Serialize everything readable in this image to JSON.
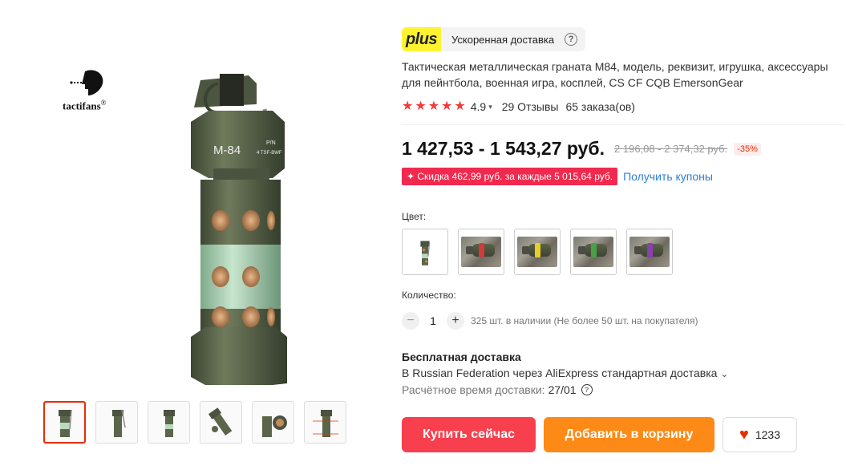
{
  "brand": {
    "name": "tactifans",
    "registered": "®"
  },
  "plus": {
    "badge": "plus",
    "text": "Ускоренная доставка",
    "help": "?"
  },
  "product": {
    "title": "Тактическая металлическая граната M84, модель, реквизит, игрушка, аксессуары для пейнтбола, военная игра, косплей, CS CF CQB EmersonGear",
    "body_marking": "M-84",
    "cap_marking_1": "P/N",
    "cap_marking_2": "4 TSF-BWF"
  },
  "rating": {
    "stars": 5,
    "value": "4.9",
    "reviews": "29 Отзывы",
    "orders": "65 заказа(ов)"
  },
  "price": {
    "current": "1 427,53 - 1 543,27 руб.",
    "old": "2 196,08 - 2 374,32 руб.",
    "discount": "-35%"
  },
  "coupon": {
    "badge": "✦ Скидка 462,99 руб. за каждые 5 015,64 руб.",
    "link": "Получить купоны"
  },
  "colors": {
    "label": "Цвет:",
    "swatches": [
      {
        "id": "grenade",
        "selected": false
      },
      {
        "id": "red",
        "band": "#d23a3a"
      },
      {
        "id": "yellow",
        "band": "#e6cf2a"
      },
      {
        "id": "green",
        "band": "#4a9f4a"
      },
      {
        "id": "purple",
        "band": "#8a3fb0"
      }
    ]
  },
  "quantity": {
    "label": "Количество:",
    "minus": "−",
    "plus": "+",
    "value": "1",
    "stock": "325 шт. в наличии (Не более 50 шт. на покупателя)"
  },
  "shipping": {
    "title": "Бесплатная доставка",
    "method": "В Russian Federation через AliExpress стандартная доставка",
    "method_chevron": "⌄",
    "eta_label": "Расчётное время доставки:",
    "eta_date": "27/01",
    "help": "?"
  },
  "actions": {
    "buy": "Купить сейчас",
    "cart": "Добавить в корзину",
    "wishlist_count": "1233"
  },
  "thumbnails": [
    "thumb-1",
    "thumb-2",
    "thumb-3",
    "thumb-4",
    "thumb-5",
    "thumb-6"
  ],
  "colors_accent": {
    "primary_red": "#f73f4e",
    "orange": "#fd8a16",
    "plus_yellow": "#fff231",
    "link_blue": "#2e7fd6",
    "star_red": "#f23c3c"
  }
}
